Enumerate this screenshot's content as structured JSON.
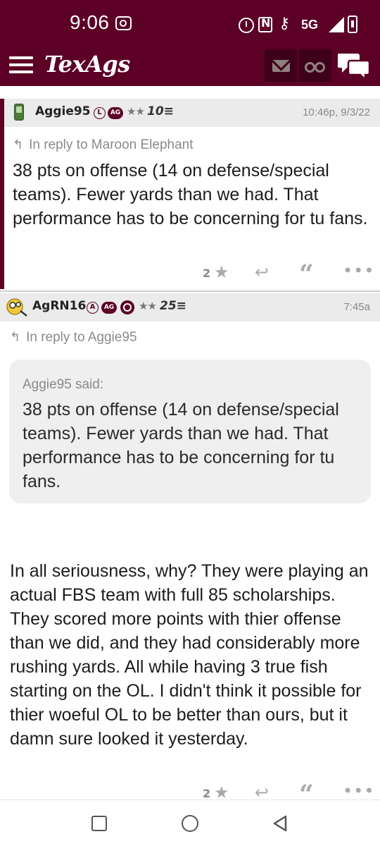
{
  "status_bar": {
    "time": "9:06",
    "network": "5G"
  },
  "app_bar": {
    "logo": "TexAgs",
    "icons": [
      "menu-icon",
      "mail-icon",
      "binoculars-icon",
      "chat-icon"
    ]
  },
  "posts": [
    {
      "username": "Aggie95",
      "badges": [
        "L",
        "AG"
      ],
      "stars": "★★",
      "level": "10≡",
      "timestamp": "10:46p, 9/3/22",
      "reply_to": "In reply to Maroon Elephant",
      "body": "38 pts on offense (14 on defense/special teams). Fewer yards than we had. That performance has to be concerning for tu fans.",
      "star_count": "2"
    },
    {
      "username": "AgRN16",
      "badges": [
        "A",
        "AG"
      ],
      "stars": "★★",
      "level": "25≡",
      "timestamp": "7:45a",
      "reply_to": "In reply to Aggie95",
      "quote_by": "Aggie95 said:",
      "quote": "38 pts on offense (14 on defense/special teams). Fewer yards than we had. That performance has to be concerning for tu fans.",
      "body": "In all seriousness, why? They were playing an actual FBS team with full 85 scholarships. They scored more points with thier offense than we did, and they had considerably more rushing yards. All while having 3 true fish starting on the OL. I didn't think it possible for thier woeful OL to be better than ours, but it damn sure looked it yesterday.",
      "star_count": "2"
    }
  ],
  "colors": {
    "brand": "#5c0025",
    "header_bg": "#ebebeb",
    "quote_bg": "#efefef"
  }
}
